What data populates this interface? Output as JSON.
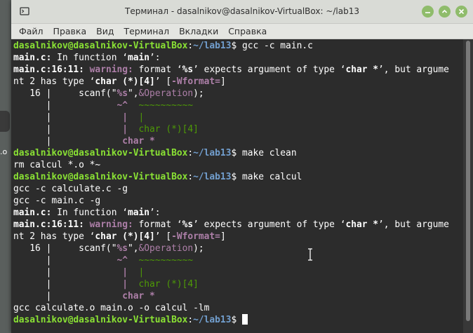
{
  "window": {
    "title": "Терминал - dasalnikov@dasalnikov-VirtualBox: ~/lab13"
  },
  "menu": [
    "Файл",
    "Правка",
    "Вид",
    "Терминал",
    "Вкладки",
    "Справка"
  ],
  "desktop": {
    "fragment_text": ".o"
  },
  "colors": {
    "prompt_user": "#8ae234",
    "prompt_path": "#729fcf",
    "warning": "#ad7fa8",
    "fixit": "#4e9a06",
    "background": "#2c2c2c"
  },
  "terminal": {
    "lines": [
      [
        {
          "t": "dasalnikov@dasalnikov-VirtualBox",
          "c": "g"
        },
        {
          "t": ":",
          "c": "w"
        },
        {
          "t": "~/lab13",
          "c": "b"
        },
        {
          "t": "$ gcc -c main.c",
          "c": "w"
        }
      ],
      [
        {
          "t": "main.c:",
          "c": "bw"
        },
        {
          "t": " In function ‘",
          "c": "w"
        },
        {
          "t": "main",
          "c": "bw"
        },
        {
          "t": "’:",
          "c": "w"
        }
      ],
      [
        {
          "t": "main.c:16:11:",
          "c": "bw"
        },
        {
          "t": " ",
          "c": "w"
        },
        {
          "t": "warning:",
          "c": "m"
        },
        {
          "t": " format ‘",
          "c": "w"
        },
        {
          "t": "%s",
          "c": "bw"
        },
        {
          "t": "’ expects argument of type ‘",
          "c": "w"
        },
        {
          "t": "char *",
          "c": "bw"
        },
        {
          "t": "’, but argume",
          "c": "w"
        }
      ],
      [
        {
          "t": "nt 2 has type ‘",
          "c": "w"
        },
        {
          "t": "char (*)[4]",
          "c": "bw"
        },
        {
          "t": "’ [",
          "c": "w"
        },
        {
          "t": "-Wformat=",
          "c": "m"
        },
        {
          "t": "]",
          "c": "w"
        }
      ],
      [
        {
          "t": "   16 |     scanf(\"",
          "c": "w"
        },
        {
          "t": "%s",
          "c": "m"
        },
        {
          "t": "\",",
          "c": "w"
        },
        {
          "t": "&Operation",
          "c": "m2"
        },
        {
          "t": ");",
          "c": "w"
        }
      ],
      [
        {
          "t": "      |            ",
          "c": "w"
        },
        {
          "t": "~^",
          "c": "m"
        },
        {
          "t": "  ",
          "c": "w"
        },
        {
          "t": "~~~~~~~~~~",
          "c": "gr"
        }
      ],
      [
        {
          "t": "      |             ",
          "c": "w"
        },
        {
          "t": "|",
          "c": "m"
        },
        {
          "t": "  ",
          "c": "w"
        },
        {
          "t": "|",
          "c": "gr"
        }
      ],
      [
        {
          "t": "      |             ",
          "c": "w"
        },
        {
          "t": "|",
          "c": "m"
        },
        {
          "t": "  ",
          "c": "w"
        },
        {
          "t": "char (*)[4]",
          "c": "gr"
        }
      ],
      [
        {
          "t": "      |             ",
          "c": "w"
        },
        {
          "t": "char *",
          "c": "m"
        }
      ],
      [
        {
          "t": "dasalnikov@dasalnikov-VirtualBox",
          "c": "g"
        },
        {
          "t": ":",
          "c": "w"
        },
        {
          "t": "~/lab13",
          "c": "b"
        },
        {
          "t": "$ make clean",
          "c": "w"
        }
      ],
      [
        {
          "t": "rm calcul *.o *~",
          "c": "w"
        }
      ],
      [
        {
          "t": "dasalnikov@dasalnikov-VirtualBox",
          "c": "g"
        },
        {
          "t": ":",
          "c": "w"
        },
        {
          "t": "~/lab13",
          "c": "b"
        },
        {
          "t": "$ make calcul",
          "c": "w"
        }
      ],
      [
        {
          "t": "gcc -c calculate.c -g",
          "c": "w"
        }
      ],
      [
        {
          "t": "gcc -c main.c -g",
          "c": "w"
        }
      ],
      [
        {
          "t": "main.c:",
          "c": "bw"
        },
        {
          "t": " In function ‘",
          "c": "w"
        },
        {
          "t": "main",
          "c": "bw"
        },
        {
          "t": "’:",
          "c": "w"
        }
      ],
      [
        {
          "t": "main.c:16:11:",
          "c": "bw"
        },
        {
          "t": " ",
          "c": "w"
        },
        {
          "t": "warning:",
          "c": "m"
        },
        {
          "t": " format ‘",
          "c": "w"
        },
        {
          "t": "%s",
          "c": "bw"
        },
        {
          "t": "’ expects argument of type ‘",
          "c": "w"
        },
        {
          "t": "char *",
          "c": "bw"
        },
        {
          "t": "’, but argume",
          "c": "w"
        }
      ],
      [
        {
          "t": "nt 2 has type ‘",
          "c": "w"
        },
        {
          "t": "char (*)[4]",
          "c": "bw"
        },
        {
          "t": "’ [",
          "c": "w"
        },
        {
          "t": "-Wformat=",
          "c": "m"
        },
        {
          "t": "]",
          "c": "w"
        }
      ],
      [
        {
          "t": "   16 |     scanf(\"",
          "c": "w"
        },
        {
          "t": "%s",
          "c": "m"
        },
        {
          "t": "\",",
          "c": "w"
        },
        {
          "t": "&Operation",
          "c": "m2"
        },
        {
          "t": ");",
          "c": "w"
        }
      ],
      [
        {
          "t": "      |            ",
          "c": "w"
        },
        {
          "t": "~^",
          "c": "m"
        },
        {
          "t": "  ",
          "c": "w"
        },
        {
          "t": "~~~~~~~~~~",
          "c": "gr"
        }
      ],
      [
        {
          "t": "      |             ",
          "c": "w"
        },
        {
          "t": "|",
          "c": "m"
        },
        {
          "t": "  ",
          "c": "w"
        },
        {
          "t": "|",
          "c": "gr"
        }
      ],
      [
        {
          "t": "      |             ",
          "c": "w"
        },
        {
          "t": "|",
          "c": "m"
        },
        {
          "t": "  ",
          "c": "w"
        },
        {
          "t": "char (*)[4]",
          "c": "gr"
        }
      ],
      [
        {
          "t": "      |             ",
          "c": "w"
        },
        {
          "t": "char *",
          "c": "m"
        }
      ],
      [
        {
          "t": "gcc calculate.o main.o -o calcul -lm",
          "c": "w"
        }
      ],
      [
        {
          "t": "dasalnikov@dasalnikov-VirtualBox",
          "c": "g"
        },
        {
          "t": ":",
          "c": "w"
        },
        {
          "t": "~/lab13",
          "c": "b"
        },
        {
          "t": "$ ",
          "c": "w"
        },
        {
          "t": "",
          "c": "cursor"
        }
      ]
    ]
  }
}
